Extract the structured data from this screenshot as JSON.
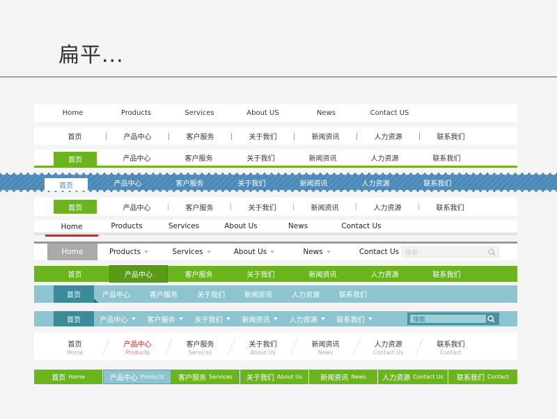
{
  "header": {
    "title": "扁平..."
  },
  "row1": [
    "Home",
    "Products",
    "Services",
    "About US",
    "News",
    "Contact US"
  ],
  "row_cn": [
    "首页",
    "产品中心",
    "客户服务",
    "关于我们",
    "新闻资讯",
    "人力资源",
    "联系我们"
  ],
  "row6": [
    "Home",
    "Products",
    "Services",
    "About Us",
    "News",
    "Contact Us"
  ],
  "row7": {
    "items": [
      "Home",
      "Products",
      "Services",
      "About Us",
      "News",
      "Contact Us"
    ],
    "search_placeholder": "搜索"
  },
  "row10": {
    "search_placeholder": "搜索"
  },
  "row11_en": [
    "Home",
    "Products",
    "Services",
    "About Us",
    "News",
    "Contact Us",
    "Contact"
  ],
  "row12_en": [
    "Home",
    "Products",
    "Services",
    "About Us",
    "News",
    "Contact Us",
    "Contact"
  ],
  "colors": {
    "green": "#6ab51e",
    "blue": "#4b89b8",
    "teal": "#8cc5cf",
    "red": "#e02020"
  }
}
